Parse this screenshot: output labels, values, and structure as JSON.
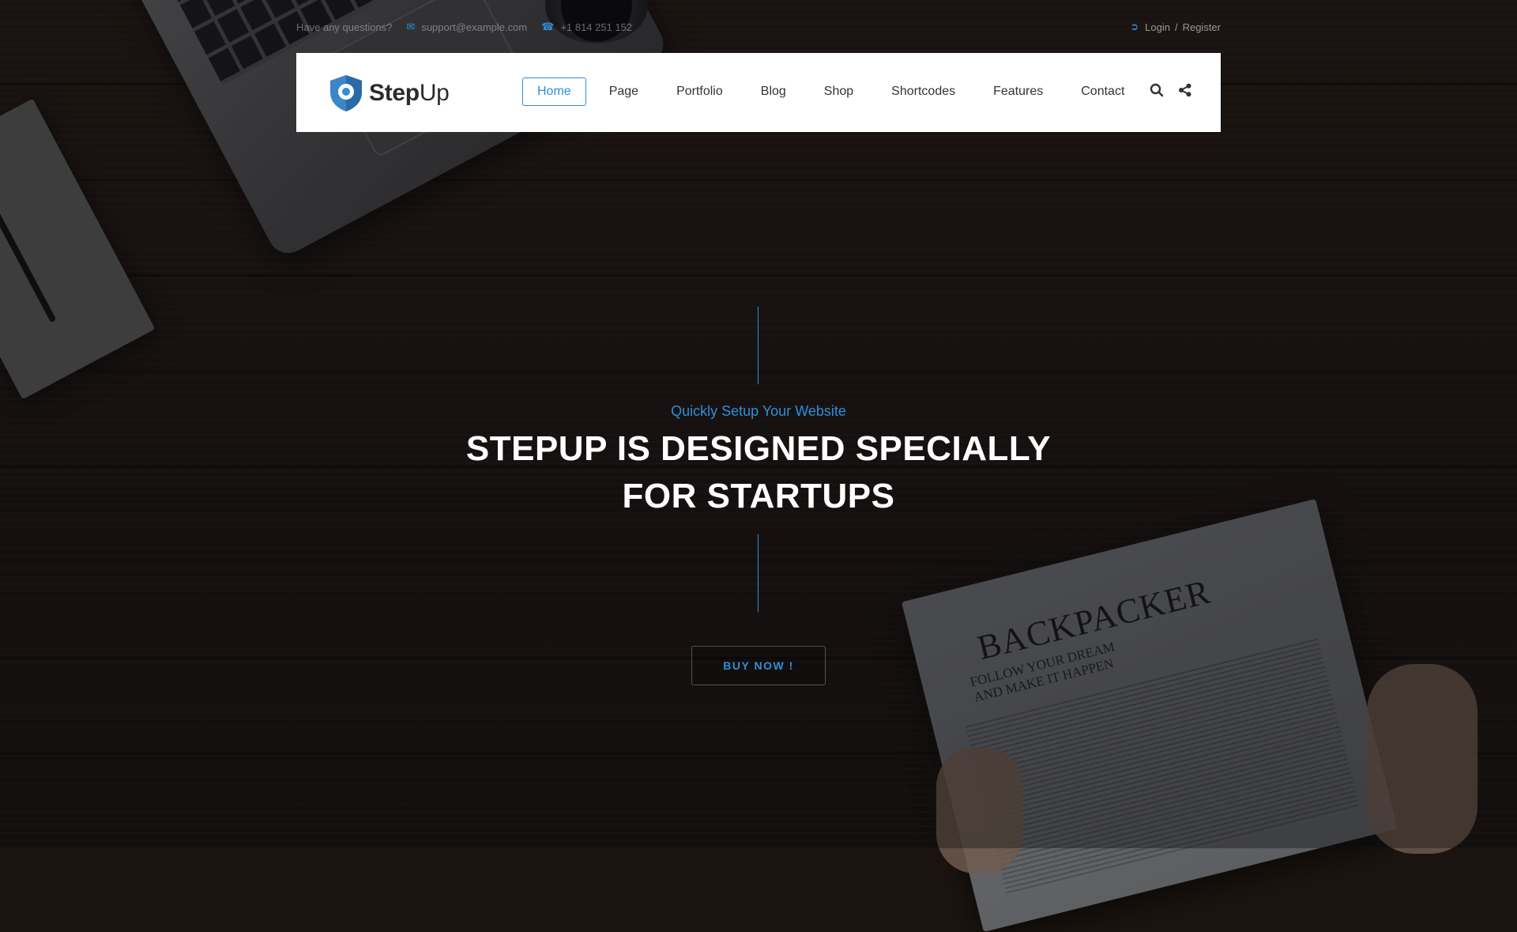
{
  "colors": {
    "accent": "#2e8ed8",
    "header_bg": "#ffffff",
    "headline": "#ffffff"
  },
  "topbar": {
    "question": "Have any questions?",
    "email_icon": "envelope-icon",
    "email": "support@example.com",
    "phone_icon": "phone-icon",
    "phone": "+1 814 251 152",
    "login_icon": "sign-in-icon",
    "login": "Login",
    "separator": "/",
    "register": "Register"
  },
  "logo": {
    "icon": "shield-icon",
    "text_bold": "Step",
    "text_light": "Up"
  },
  "nav": {
    "items": [
      {
        "label": "Home",
        "active": true
      },
      {
        "label": "Page"
      },
      {
        "label": "Portfolio"
      },
      {
        "label": "Blog"
      },
      {
        "label": "Shop"
      },
      {
        "label": "Shortcodes"
      },
      {
        "label": "Features"
      },
      {
        "label": "Contact"
      }
    ],
    "search_icon": "search-icon",
    "share_icon": "share-icon"
  },
  "hero": {
    "tagline": "Quickly Setup Your Website",
    "headline_line1": "STEPUP IS DESIGNED SPECIALLY",
    "headline_line2": "FOR STARTUPS",
    "button": "BUY NOW !"
  },
  "background": {
    "newspaper_title": "BACKPACKER",
    "newspaper_sub": "FOLLOW YOUR DREAM AND MAKE IT HAPPEN"
  }
}
